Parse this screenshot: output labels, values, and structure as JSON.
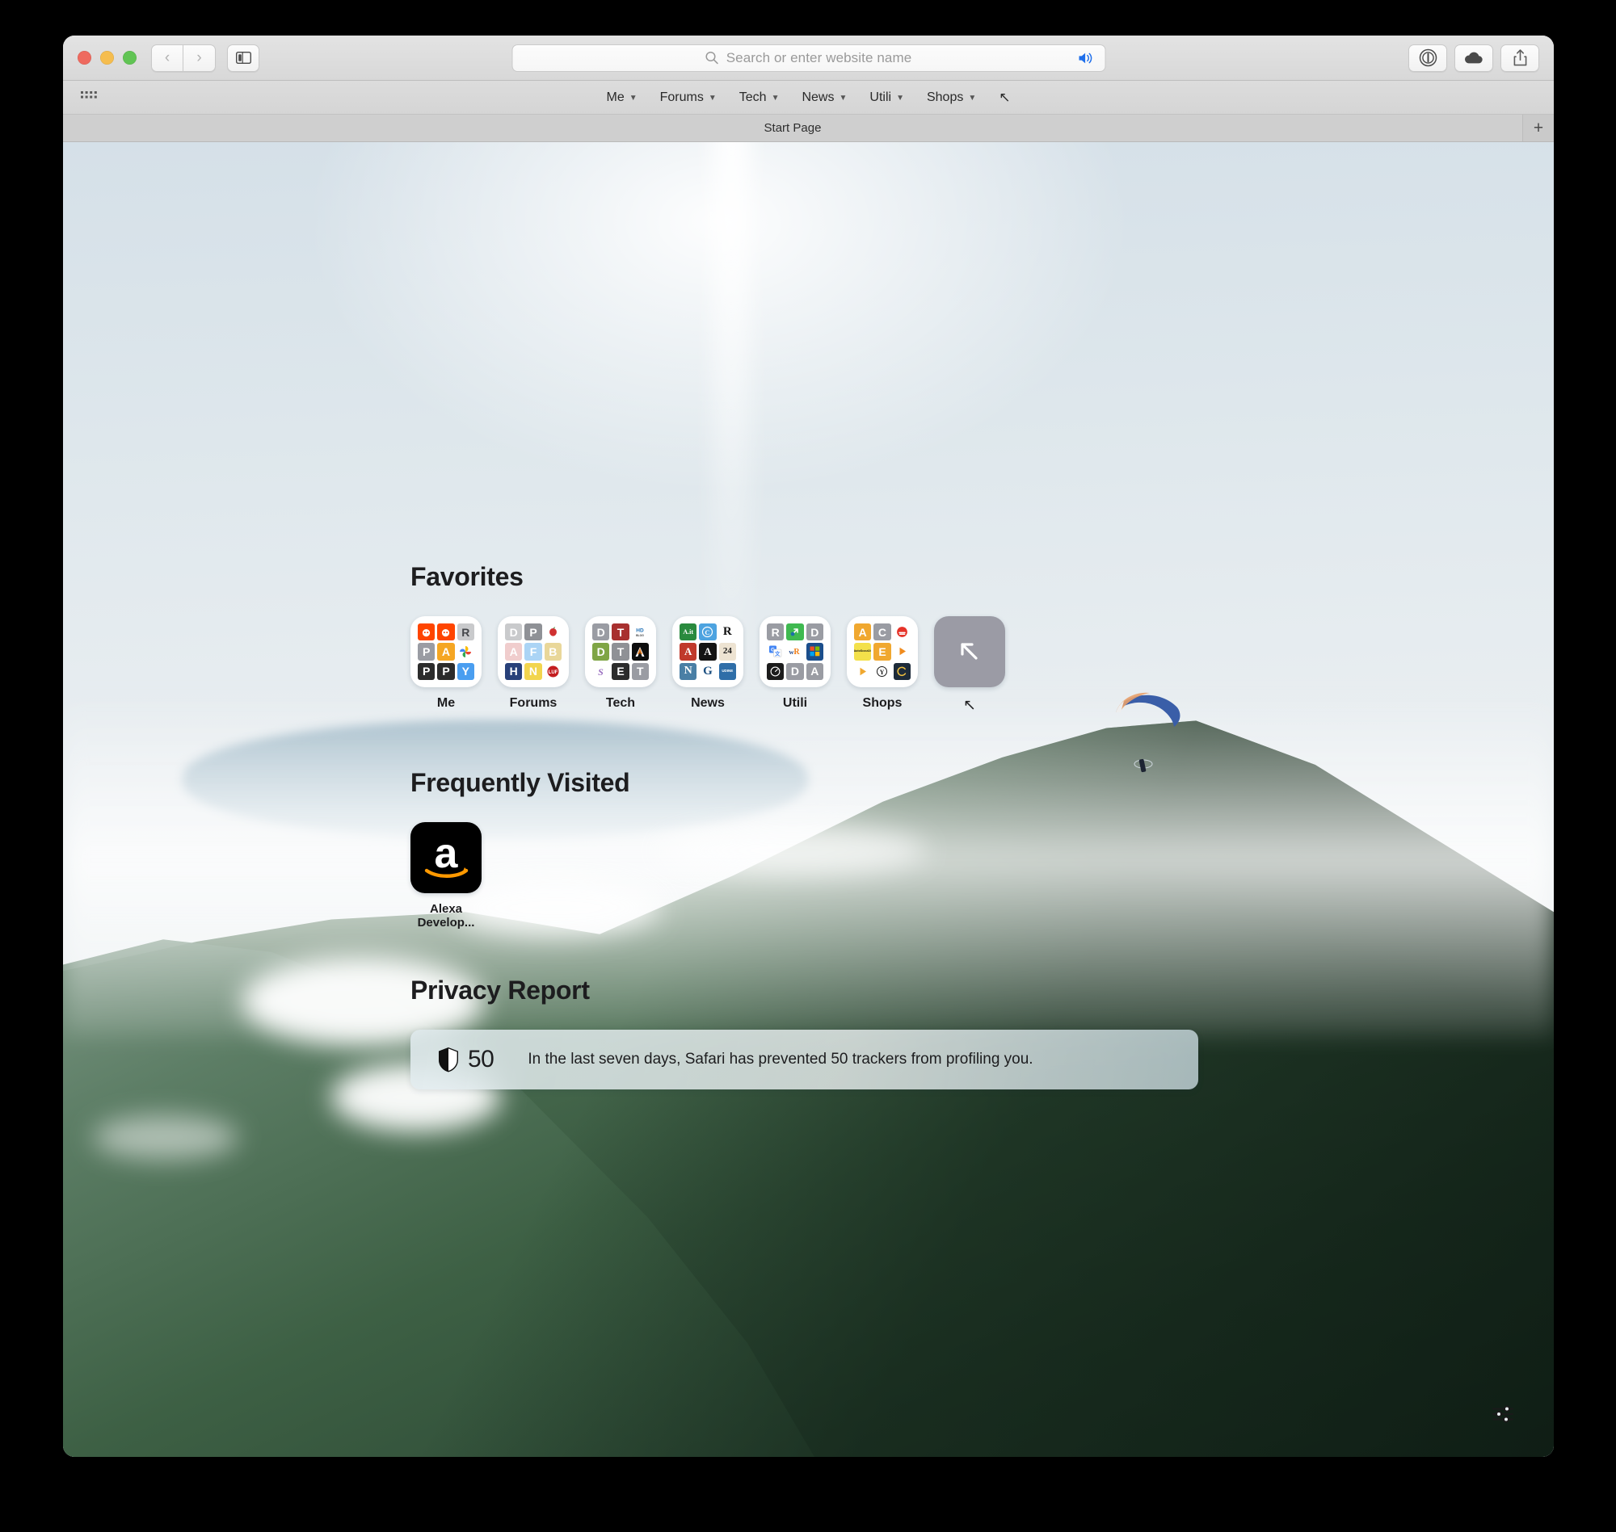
{
  "window": {
    "traffic_lights": [
      "close",
      "minimize",
      "zoom"
    ],
    "nav": {
      "back": "Back",
      "forward": "Forward"
    },
    "sidebar_button": "Show Sidebar",
    "tab_overview_button": "Tab Overview"
  },
  "toolbar": {
    "address_bar": {
      "value": "",
      "placeholder": "Search or enter website name"
    },
    "audio_button": "speaker-icon",
    "right_buttons": [
      {
        "name": "onepassword-button",
        "icon": "1password-icon"
      },
      {
        "name": "icloud-button",
        "icon": "cloud-icon"
      },
      {
        "name": "share-button",
        "icon": "share-icon"
      }
    ]
  },
  "bookmarks_bar": {
    "grid_icon": "app-grid-icon",
    "items": [
      {
        "label": "Me",
        "has_menu": true
      },
      {
        "label": "Forums",
        "has_menu": true
      },
      {
        "label": "Tech",
        "has_menu": true
      },
      {
        "label": "News",
        "has_menu": true
      },
      {
        "label": "Utili",
        "has_menu": true
      },
      {
        "label": "Shops",
        "has_menu": true
      }
    ],
    "overflow_glyph": "↖"
  },
  "tab_bar": {
    "tabs": [
      {
        "title": "Start Page",
        "active": true
      }
    ],
    "new_tab_label": "+"
  },
  "start_page": {
    "favorites": {
      "title": "Favorites",
      "items": [
        {
          "label": "Me",
          "tiles": [
            {
              "text": "",
              "bg": "#ff4500",
              "type": "reddit"
            },
            {
              "text": "",
              "bg": "#ff4500",
              "type": "reddit"
            },
            {
              "text": "R",
              "bg": "#c9cacc",
              "fg": "#45474b"
            },
            {
              "text": "P",
              "bg": "#9a9ca3",
              "fg": "#ffffff"
            },
            {
              "text": "A",
              "bg": "#f5a623",
              "fg": "#ffffff"
            },
            {
              "text": "",
              "bg": "#ffffff",
              "type": "photos"
            },
            {
              "text": "P",
              "bg": "#2c2c2c",
              "fg": "#ffffff"
            },
            {
              "text": "P",
              "bg": "#2c2c2c",
              "fg": "#ffffff"
            },
            {
              "text": "Y",
              "bg": "#4a9ef0",
              "fg": "#ffffff"
            }
          ]
        },
        {
          "label": "Forums",
          "tiles": [
            {
              "text": "D",
              "bg": "#c9cacc",
              "fg": "#ffffff"
            },
            {
              "text": "P",
              "bg": "#8f9196",
              "fg": "#ffffff"
            },
            {
              "text": "",
              "bg": "#ffffff",
              "type": "apple-red"
            },
            {
              "text": "A",
              "bg": "#f0cdcd",
              "fg": "#ffffff"
            },
            {
              "text": "F",
              "bg": "#abd4f5",
              "fg": "#ffffff"
            },
            {
              "text": "B",
              "bg": "#e9d79a",
              "fg": "#ffffff"
            },
            {
              "text": "H",
              "bg": "#28417a",
              "fg": "#ffffff"
            },
            {
              "text": "N",
              "bg": "#f2d54e",
              "fg": "#ffffff"
            },
            {
              "text": "LUF",
              "bg": "#ffffff",
              "fg": "#c41e20",
              "type": "luf"
            }
          ]
        },
        {
          "label": "Tech",
          "tiles": [
            {
              "text": "D",
              "bg": "#9a9ca3",
              "fg": "#ffffff"
            },
            {
              "text": "T",
              "bg": "#a8302f",
              "fg": "#ffffff"
            },
            {
              "text": "HD",
              "bg": "#ffffff",
              "fg": "#1f6fb5",
              "type": "hd"
            },
            {
              "text": "D",
              "bg": "#7fa545",
              "fg": "#ffffff"
            },
            {
              "text": "T",
              "bg": "#8f9196",
              "fg": "#ffffff"
            },
            {
              "text": "A",
              "bg": "#0d0d0d",
              "fg": "#ffffff",
              "type": "arch"
            },
            {
              "text": "S",
              "bg": "#ffffff",
              "fg": "#9a6fc0",
              "type": "s-logo"
            },
            {
              "text": "E",
              "bg": "#2c2c2c",
              "fg": "#ffffff"
            },
            {
              "text": "T",
              "bg": "#9a9ca3",
              "fg": "#ffffff"
            }
          ]
        },
        {
          "label": "News",
          "tiles": [
            {
              "text": "A.it",
              "bg": "#2a8a3e",
              "fg": "#ffffff",
              "type": "ait"
            },
            {
              "text": "C",
              "bg": "#4da3e0",
              "fg": "#ffffff",
              "type": "circle-c"
            },
            {
              "text": "R",
              "bg": "#ffffff",
              "fg": "#111111",
              "type": "serif"
            },
            {
              "text": "A",
              "bg": "#c0392b",
              "fg": "#ffffff",
              "type": "serif"
            },
            {
              "text": "A",
              "bg": "#141414",
              "fg": "#ffffff",
              "type": "serif"
            },
            {
              "text": "24",
              "bg": "#ede3d2",
              "fg": "#1a1a1a",
              "type": "serif"
            },
            {
              "text": "N",
              "bg": "#4a7fa5",
              "fg": "#ffffff",
              "type": "serif"
            },
            {
              "text": "G",
              "bg": "#ffffff",
              "fg": "#1b4f80",
              "type": "serif"
            },
            {
              "text": "UDINE",
              "bg": "#2f6ea8",
              "fg": "#ffffff",
              "type": "udine"
            }
          ]
        },
        {
          "label": "Utili",
          "tiles": [
            {
              "text": "R",
              "bg": "#9a9ca3",
              "fg": "#ffffff"
            },
            {
              "text": "",
              "bg": "#3fb950",
              "type": "green-arrow"
            },
            {
              "text": "D",
              "bg": "#9a9ca3",
              "fg": "#ffffff"
            },
            {
              "text": "",
              "bg": "#ffffff",
              "type": "gtranslate"
            },
            {
              "text": "wR",
              "bg": "#ffffff",
              "fg": "#f07f1a",
              "type": "wr"
            },
            {
              "text": "",
              "bg": "#1b4e8c",
              "type": "office"
            },
            {
              "text": "",
              "bg": "#1c1c1c",
              "type": "speedometer"
            },
            {
              "text": "D",
              "bg": "#9a9ca3",
              "fg": "#ffffff"
            },
            {
              "text": "A",
              "bg": "#9a9ca3",
              "fg": "#ffffff"
            }
          ]
        },
        {
          "label": "Shops",
          "tiles": [
            {
              "text": "A",
              "bg": "#f0a830",
              "fg": "#ffffff"
            },
            {
              "text": "C",
              "bg": "#9a9ca3",
              "fg": "#ffffff"
            },
            {
              "text": "",
              "bg": "#ffffff",
              "type": "red-circle"
            },
            {
              "text": "AutoScout24",
              "bg": "#f3e04a",
              "fg": "#1a1a1a",
              "type": "autoscout"
            },
            {
              "text": "E",
              "bg": "#f0a830",
              "fg": "#ffffff"
            },
            {
              "text": "",
              "bg": "#ffffff",
              "type": "orange-play"
            },
            {
              "text": "",
              "bg": "#ffffff",
              "type": "orange-play"
            },
            {
              "text": "Y",
              "bg": "#ffffff",
              "fg": "#1a1a1a",
              "type": "circle-y"
            },
            {
              "text": "C",
              "bg": "#1d2b3a",
              "fg": "#f0c040",
              "type": "circle-c2"
            }
          ]
        },
        {
          "label": "↖",
          "is_blank": true,
          "icon": "arrow-up-left-icon"
        }
      ]
    },
    "frequently_visited": {
      "title": "Frequently Visited",
      "items": [
        {
          "label": "Alexa Develop...",
          "icon": "amazon-logo"
        }
      ]
    },
    "privacy_report": {
      "title": "Privacy Report",
      "shield_icon": "shield-icon",
      "tracker_count": "50",
      "message": "In the last seven days, Safari has prevented 50 trackers from profiling you."
    },
    "settings_button": "sliders-icon"
  },
  "colors": {
    "accent": "#0a84ff",
    "toolbar_bg": "#dcdcdc",
    "text_primary": "#1d1d1f",
    "placeholder": "#9a9a9a"
  }
}
